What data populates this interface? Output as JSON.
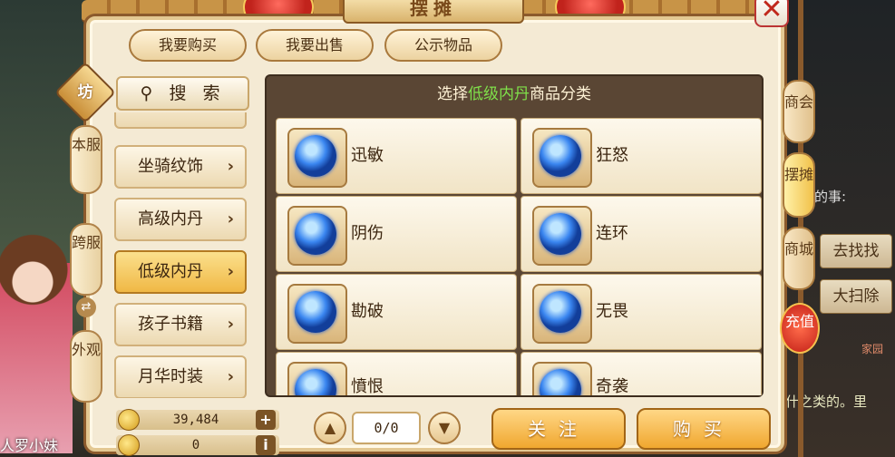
{
  "window": {
    "title": "摆摊",
    "close_icon": "close-icon"
  },
  "top_tabs": [
    "我要购买",
    "我要出售",
    "公示物品"
  ],
  "left_tabs": {
    "badge": "坊",
    "items": [
      "本服",
      "跨服",
      "外观"
    ],
    "swap_icon": "swap-icon"
  },
  "search": {
    "label": "搜 索",
    "icon": "search-icon"
  },
  "categories": [
    {
      "label": "坐骑纹饰",
      "active": false
    },
    {
      "label": "高级内丹",
      "active": false
    },
    {
      "label": "低级内丹",
      "active": true
    },
    {
      "label": "孩子书籍",
      "active": false
    },
    {
      "label": "月华时装",
      "active": false
    }
  ],
  "goods": {
    "header_prefix": "选择",
    "header_highlight": "低级内丹",
    "header_suffix": "商品分类",
    "highlight_color": "#7fe04a",
    "items": [
      "迅敏",
      "狂怒",
      "阴伤",
      "连环",
      "勘破",
      "无畏",
      "憤恨",
      "奇袭"
    ]
  },
  "currency": {
    "gold": "39,484",
    "gold_action": "+",
    "silver": "0",
    "silver_action": "i"
  },
  "pager": {
    "value": "0/0",
    "prev_icon": "chevron-up-icon",
    "next_icon": "chevron-down-icon"
  },
  "actions": {
    "follow": "关注",
    "buy": "购买"
  },
  "right_tabs": [
    "商会",
    "摆摊",
    "商城",
    "充值"
  ],
  "background": {
    "task_text": "要做的事:",
    "btn1": "去找找",
    "btn2": "大扫除",
    "chat": "什之类的。里",
    "home": "家园",
    "character_name": "人罗小妹"
  }
}
